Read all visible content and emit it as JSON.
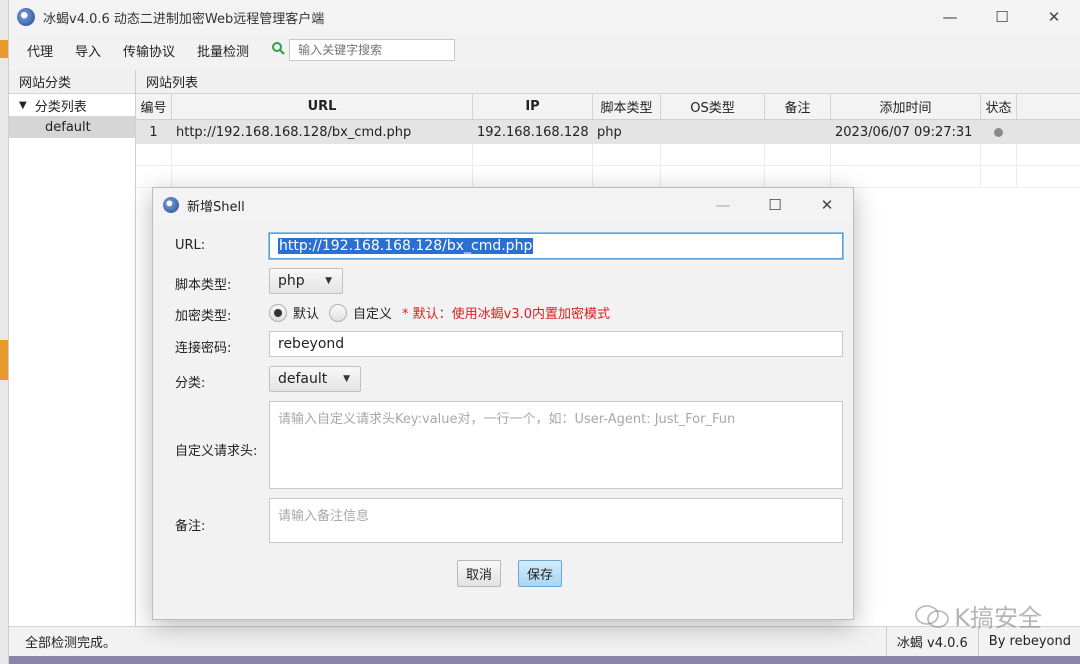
{
  "window": {
    "title": "冰蝎v4.0.6 动态二进制加密Web远程管理客户端",
    "minimize": "—",
    "maximize": "☐",
    "close": "✕"
  },
  "menu": {
    "items": [
      "代理",
      "导入",
      "传输协议",
      "批量检测"
    ],
    "search_placeholder": "输入关键字搜索"
  },
  "sidebar": {
    "header": "网站分类",
    "root_label": "分类列表",
    "child_label": "default"
  },
  "main": {
    "header": "网站列表",
    "columns": [
      "编号",
      "URL",
      "IP",
      "脚本类型",
      "OS类型",
      "备注",
      "添加时间",
      "状态"
    ],
    "rows": [
      {
        "id": "1",
        "url": "http://192.168.168.128/bx_cmd.php",
        "ip": "192.168.168.128",
        "script": "php",
        "os": "",
        "note": "",
        "time": "2023/06/07 09:27:31",
        "status": "gray"
      }
    ]
  },
  "dialog": {
    "title": "新增Shell",
    "url_label": "URL:",
    "url_value": "http://192.168.168.128/bx_cmd.php",
    "script_label": "脚本类型:",
    "script_value": "php",
    "enc_label": "加密类型:",
    "enc_default": "默认",
    "enc_custom": "自定义",
    "enc_note": "* 默认：使用冰蝎v3.0内置加密模式",
    "pwd_label": "连接密码:",
    "pwd_value": "rebeyond",
    "cat_label": "分类:",
    "cat_value": "default",
    "headers_label": "自定义请求头:",
    "headers_placeholder": "请输入自定义请求头Key:value对，一行一个，如：User-Agent: Just_For_Fun",
    "remark_label": "备注:",
    "remark_placeholder": "请输入备注信息",
    "cancel": "取消",
    "save": "保存"
  },
  "statusbar": {
    "message": "全部检测完成。",
    "version": "冰蝎 v4.0.6",
    "author": "By rebeyond"
  },
  "watermark": "K搞安全",
  "colors": {
    "accent": "#5a9fd6",
    "note": "#e02020",
    "selection": "#2b6fd3"
  }
}
